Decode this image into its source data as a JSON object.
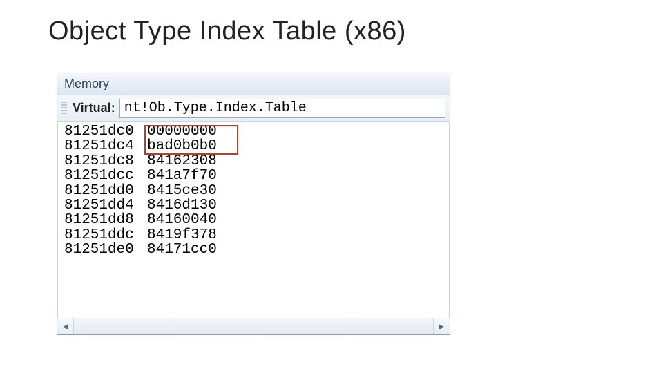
{
  "slide": {
    "title": "Object Type Index Table (x86)"
  },
  "window": {
    "title": "Memory"
  },
  "toolbar": {
    "label": "Virtual:",
    "input_value": "nt!Ob.Type.Index.Table"
  },
  "memory": [
    {
      "addr": "81251dc0",
      "val": "00000000"
    },
    {
      "addr": "81251dc4",
      "val": "bad0b0b0"
    },
    {
      "addr": "81251dc8",
      "val": "84162308"
    },
    {
      "addr": "81251dcc",
      "val": "841a7f70"
    },
    {
      "addr": "81251dd0",
      "val": "8415ce30"
    },
    {
      "addr": "81251dd4",
      "val": "8416d130"
    },
    {
      "addr": "81251dd8",
      "val": "84160040"
    },
    {
      "addr": "81251ddc",
      "val": "8419f378"
    },
    {
      "addr": "81251de0",
      "val": "84171cc0"
    }
  ],
  "scroll": {
    "left": "◄",
    "right": "►"
  }
}
